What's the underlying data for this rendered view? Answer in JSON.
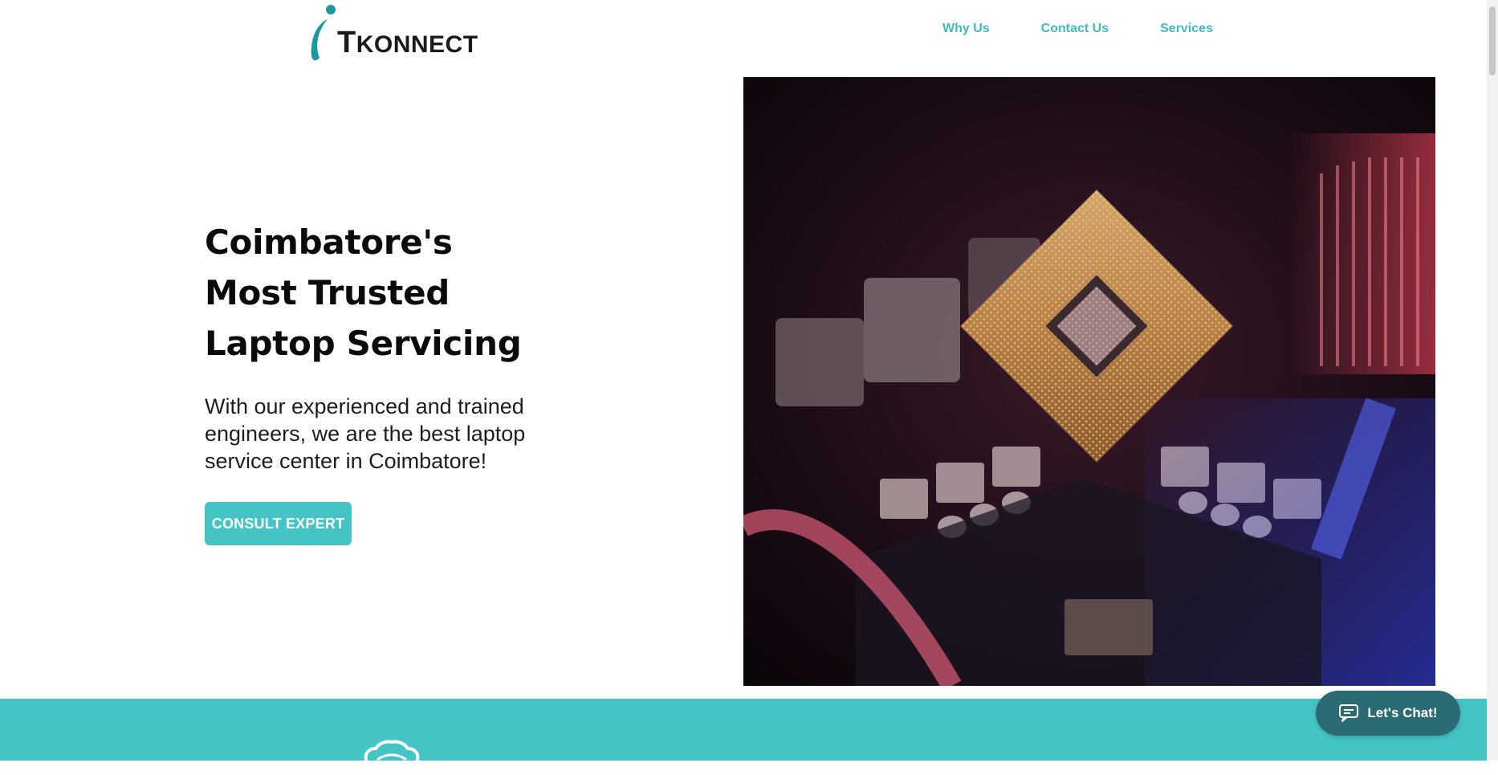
{
  "brand": {
    "logo_text_first": "T",
    "logo_text_rest": "KONNECT",
    "logo_icon": "itkonnect-i-logo",
    "accent_color": "#45c4c6",
    "logo_color": "#1a9a9e"
  },
  "nav": {
    "items": [
      {
        "label": "Why Us"
      },
      {
        "label": "Contact Us"
      },
      {
        "label": "Services"
      }
    ]
  },
  "hero": {
    "title_lines": [
      "Coimbatore's",
      "Most Trusted",
      "Laptop Servicing"
    ],
    "description": "With our experienced and trained engineers, we are the best laptop service center in Coimbatore!",
    "cta_label": "CONSULT EXPERT",
    "image_icon": "motherboard-cpu-photo"
  },
  "chat": {
    "label": "Let's Chat!",
    "icon": "chat-bubble-icon",
    "color": "#2b6b74"
  },
  "band": {
    "icon": "badge-icon",
    "color": "#45c4c6"
  }
}
